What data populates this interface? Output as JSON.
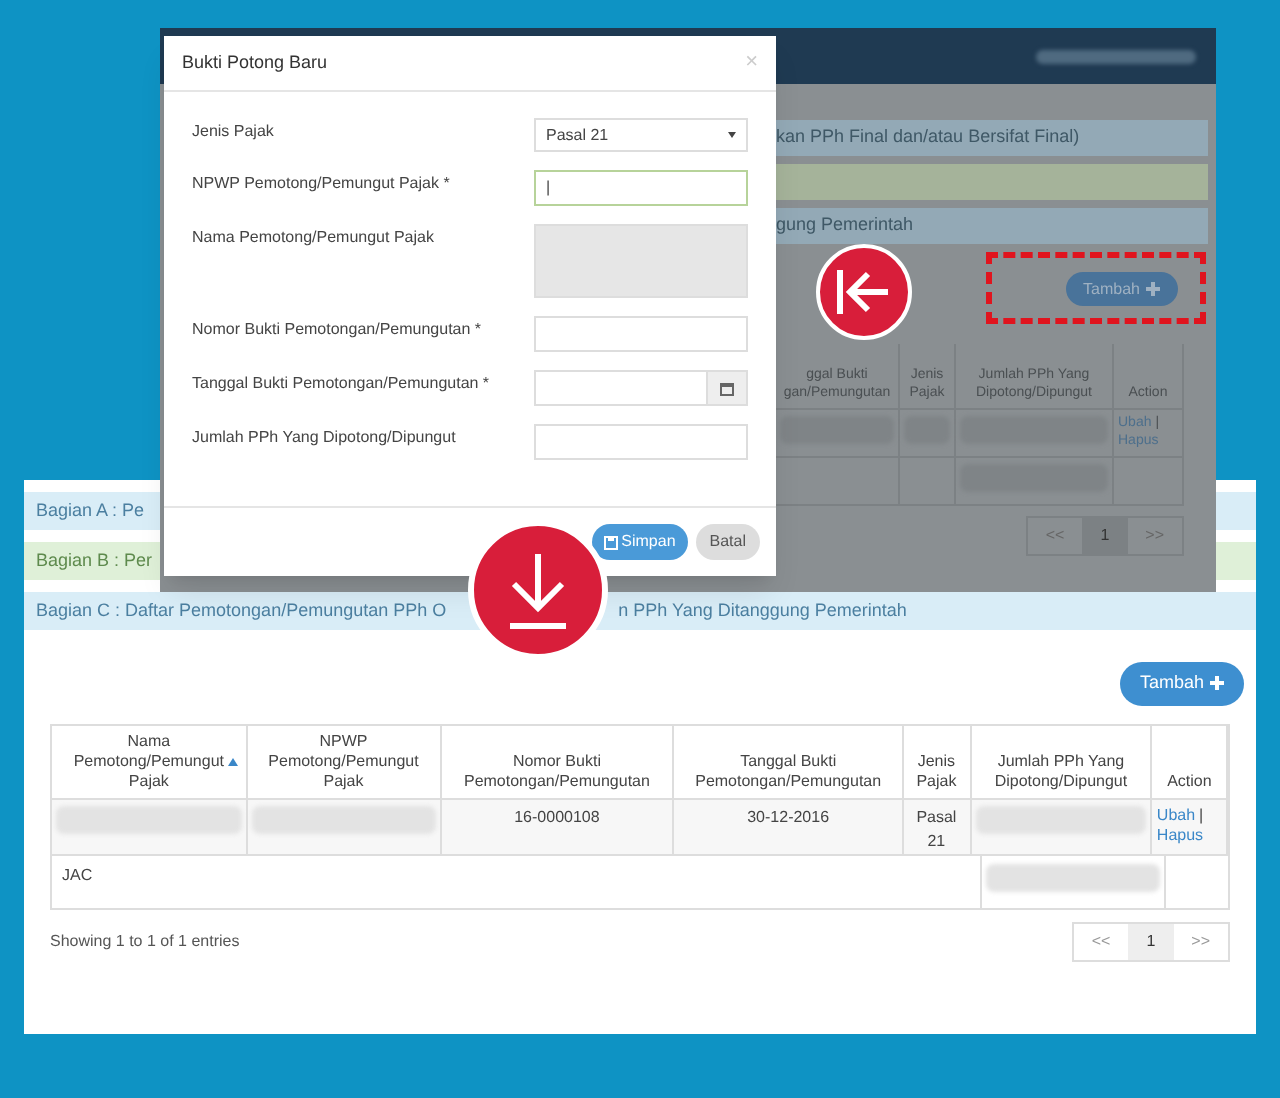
{
  "background_window": {
    "section_bars": [
      {
        "text": "kan PPh Final dan/atau Bersifat Final)",
        "color": "#93a9b6"
      },
      {
        "color": "#a5b39a"
      },
      {
        "text": "gung Pemerintah",
        "color": "#93a9b6"
      }
    ],
    "add_button": "Tambah",
    "table": {
      "columns": [
        "ggal Bukti\ngan/Pemungutan",
        "Jenis\nPajak",
        "Jumlah PPh Yang\nDipotong/Dipungut",
        "Action"
      ],
      "rows": [
        {
          "cells": [
            {
              "kind": "blurred"
            },
            {
              "kind": "blurred"
            },
            {
              "kind": "blurred"
            },
            {
              "kind": "links",
              "links": [
                "Ubah",
                "Hapus"
              ],
              "separator": "|"
            }
          ]
        },
        {
          "cells": [
            {
              "kind": "empty"
            },
            {
              "kind": "empty"
            },
            {
              "kind": "blurred"
            },
            {
              "kind": "empty"
            }
          ]
        }
      ]
    },
    "pagination": [
      {
        "label": "<<",
        "selected": false
      },
      {
        "label": "1",
        "selected": true
      },
      {
        "label": ">>",
        "selected": false
      }
    ]
  },
  "dialog": {
    "title": "Bukti Potong Baru",
    "close": "×",
    "fields": [
      {
        "kind": "select",
        "label": "Jenis Pajak",
        "value": "Pasal 21"
      },
      {
        "kind": "text",
        "label": "NPWP Pemotong/Pemungut Pajak *",
        "value": "|",
        "focused": true
      },
      {
        "kind": "textarea",
        "label": "Nama Pemotong/Pemungut Pajak",
        "disabled": true
      },
      {
        "kind": "text",
        "label": "Nomor Bukti Pemotongan/Pemungutan *",
        "focused": false
      },
      {
        "kind": "date",
        "label": "Tanggal Bukti Pemotongan/Pemungutan *"
      },
      {
        "kind": "text",
        "label": "Jumlah PPh Yang Dipotong/Dipungut",
        "focused": false
      }
    ],
    "buttons": [
      {
        "label": "Simpan",
        "kind": "primary"
      },
      {
        "label": "Batal",
        "kind": "default"
      }
    ]
  },
  "main_window": {
    "section_bars": [
      {
        "text": "Bagian A : Pe",
        "color": "#d9edf7"
      },
      {
        "text": "Bagian B : Per",
        "color": "#dff0d8"
      },
      {
        "text": "Bagian C : Daftar Pemotongan/Pemungutan PPh O",
        "text_2": "n PPh Yang Ditanggung Pemerintah",
        "color": "#d9edf7"
      }
    ],
    "add_button": "Tambah",
    "table": {
      "columns": [
        {
          "label": "Nama\nPemotong/Pemungut\nPajak",
          "sorted": true
        },
        {
          "label": "NPWP\nPemotong/Pemungut\nPajak",
          "sorted": false
        },
        {
          "label": "Nomor Bukti\nPemotongan/Pemungutan",
          "sorted": false
        },
        {
          "label": "Tanggal Bukti\nPemotongan/Pemungutan",
          "sorted": false
        },
        {
          "label": "Jenis\nPajak",
          "sorted": false
        },
        {
          "label": "Jumlah PPh Yang\nDipotong/Dipungut",
          "sorted": false
        },
        {
          "label": "Action",
          "sorted": false
        }
      ],
      "rows": [
        {
          "cells": [
            {
              "kind": "blurred"
            },
            {
              "kind": "blurred"
            },
            {
              "kind": "text",
              "text": "16-0000108"
            },
            {
              "kind": "text",
              "text": "30-12-2016"
            },
            {
              "kind": "text",
              "text": "Pasal\n21"
            },
            {
              "kind": "blurred"
            },
            {
              "kind": "links",
              "links": [
                "Ubah",
                "Hapus"
              ],
              "separator": "|"
            }
          ]
        }
      ],
      "footer": {
        "label": "JAC",
        "total": {
          "kind": "blurred"
        }
      }
    },
    "info": "Showing 1 to 1 of 1 entries",
    "pagination": [
      {
        "label": "<<",
        "selected": false
      },
      {
        "label": "1",
        "selected": true
      },
      {
        "label": ">>",
        "selected": false
      }
    ]
  }
}
